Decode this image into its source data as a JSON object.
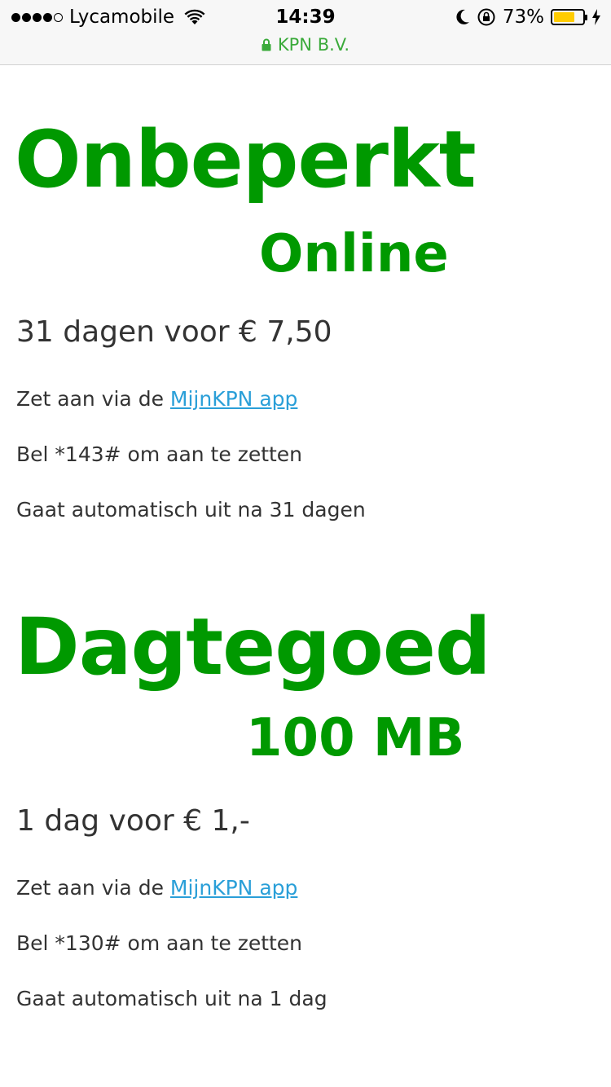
{
  "status_bar": {
    "carrier": "Lycamobile",
    "time": "14:39",
    "battery_percent": "73%",
    "battery_level": 0.73,
    "battery_color": "#ffcc00"
  },
  "browser": {
    "url_label": "KPN B.V.",
    "accent_color": "#3aaa3a"
  },
  "offers": [
    {
      "title": "Onbeperkt",
      "subtitle": "Online",
      "price": "31 dagen voor € 7,50",
      "activate_prefix": "Zet aan via de ",
      "activate_link": "MijnKPN app",
      "call_text": "Bel *143# om aan te zetten",
      "expiry_text": "Gaat automatisch uit na 31 dagen"
    },
    {
      "title": "Dagtegoed",
      "subtitle": "100 MB",
      "price": "1 dag voor € 1,-",
      "activate_prefix": "Zet aan via de ",
      "activate_link": "MijnKPN app",
      "call_text": "Bel *130# om aan te zetten",
      "expiry_text": "Gaat automatisch uit na 1 dag"
    }
  ],
  "colors": {
    "brand_green": "#009900",
    "link_blue": "#2a9fd8",
    "text": "#333333"
  }
}
